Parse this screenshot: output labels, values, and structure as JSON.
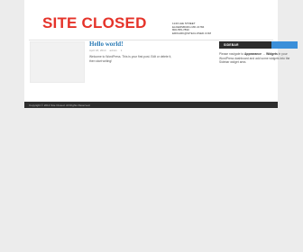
{
  "header": {
    "logo_text": "SITE CLOSED",
    "contact": [
      "1140 LEE STREET",
      "ELDERSBURG MD 21784",
      "800-555-7890",
      "ERIKARK@SITECLOSED.COM"
    ]
  },
  "post": {
    "title": "Hello world!",
    "date": "April 18, 2014",
    "author": "admin",
    "comments": "1",
    "body": "Welcome to WordPress. This is your first post. Edit or delete it, then start writing!"
  },
  "sidebar": {
    "widget_title": "SIDEBAR",
    "text_before": "Please navigate to ",
    "appearance": "Appearance",
    "arrow": " → ",
    "widgets": "Widgets",
    "text_after": " in your WordPress dashboard and add some widgets into the Sidebar widget area."
  },
  "footer": {
    "copyright": "Copyright © 2014 Site Closed. All Rights Reserved."
  }
}
